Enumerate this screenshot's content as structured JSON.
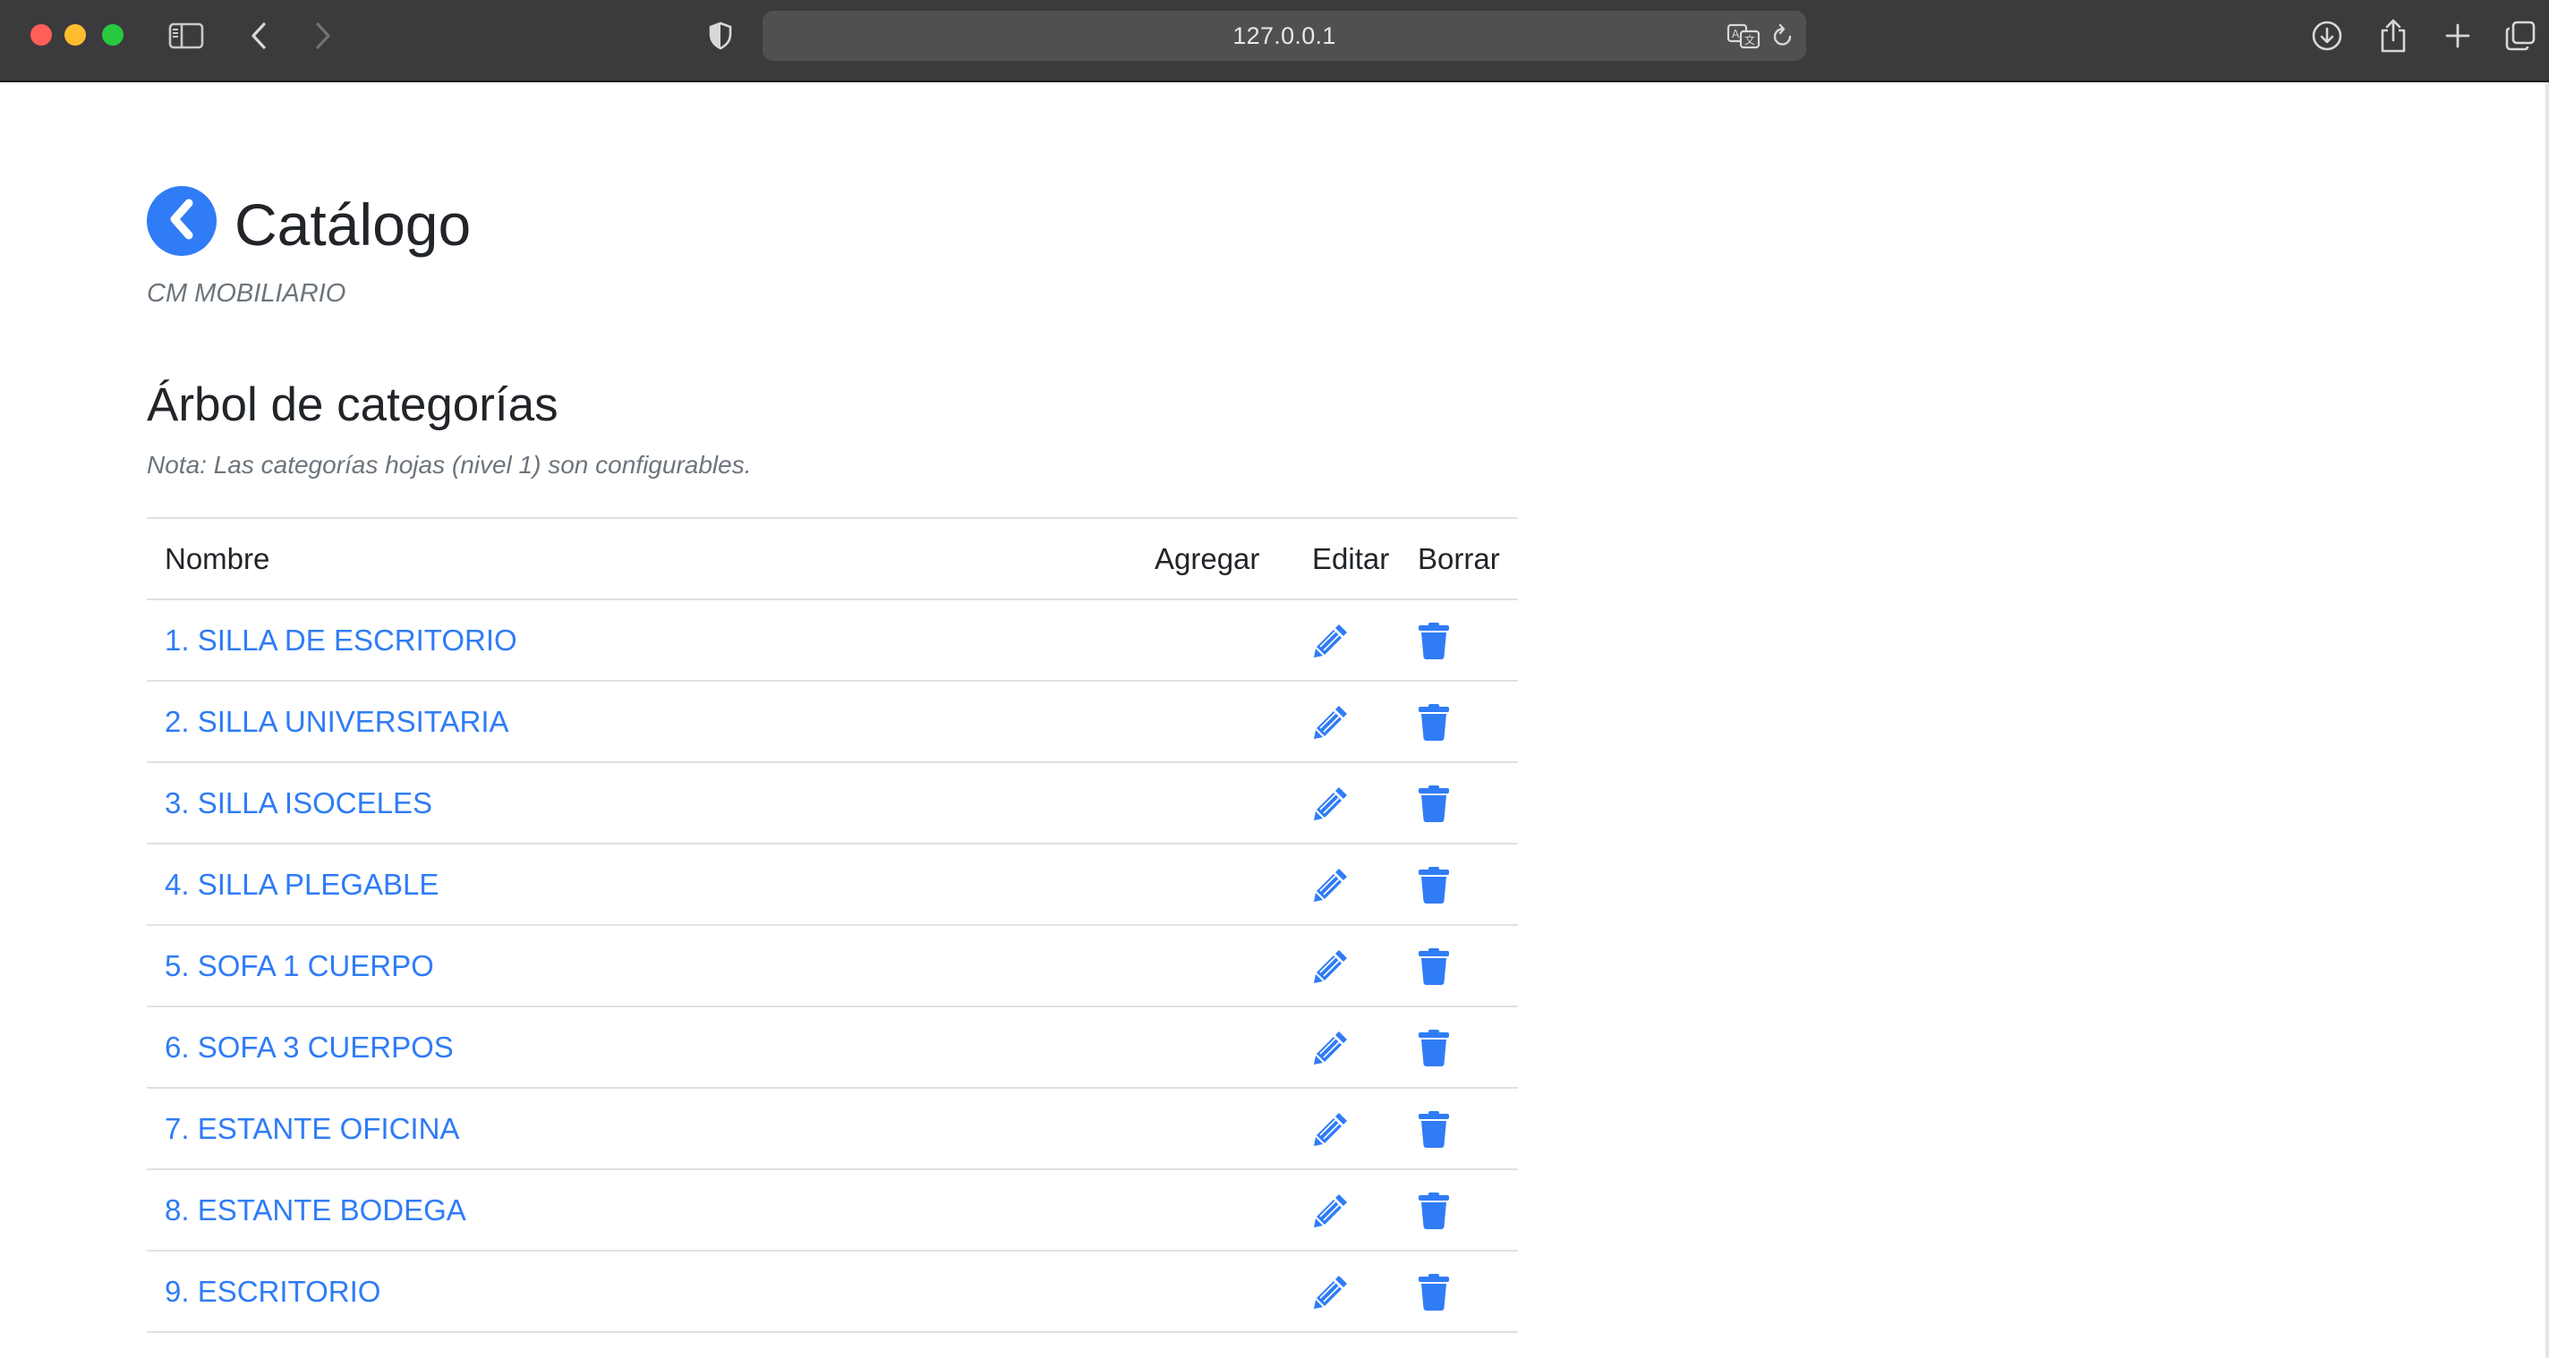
{
  "browser": {
    "url": "127.0.0.1"
  },
  "header": {
    "title": "Catálogo",
    "subtitle": "CM MOBILIARIO"
  },
  "section": {
    "title": "Árbol de categorías",
    "note": "Nota: Las categorías hojas (nivel 1) son configurables."
  },
  "table": {
    "columns": [
      "Nombre",
      "Agregar",
      "Editar",
      "Borrar"
    ],
    "rows": [
      {
        "name": "1. SILLA DE ESCRITORIO"
      },
      {
        "name": "2. SILLA UNIVERSITARIA"
      },
      {
        "name": "3. SILLA ISOCELES"
      },
      {
        "name": "4. SILLA PLEGABLE"
      },
      {
        "name": "5. SOFA 1 CUERPO"
      },
      {
        "name": "6. SOFA 3 CUERPOS"
      },
      {
        "name": "7. ESTANTE OFICINA"
      },
      {
        "name": "8. ESTANTE BODEGA"
      },
      {
        "name": "9. ESCRITORIO"
      }
    ]
  },
  "colors": {
    "accent": "#2f7cf6",
    "muted": "#6c757d",
    "chrome": "#3b3b3d"
  },
  "icons": [
    "sidebar-icon",
    "back-chevron-icon",
    "forward-chevron-icon",
    "shield-icon",
    "translate-icon",
    "reload-icon",
    "download-icon",
    "share-icon",
    "new-tab-icon",
    "tabs-overview-icon",
    "chevron-left-circle-icon",
    "pencil-icon",
    "trash-icon"
  ]
}
